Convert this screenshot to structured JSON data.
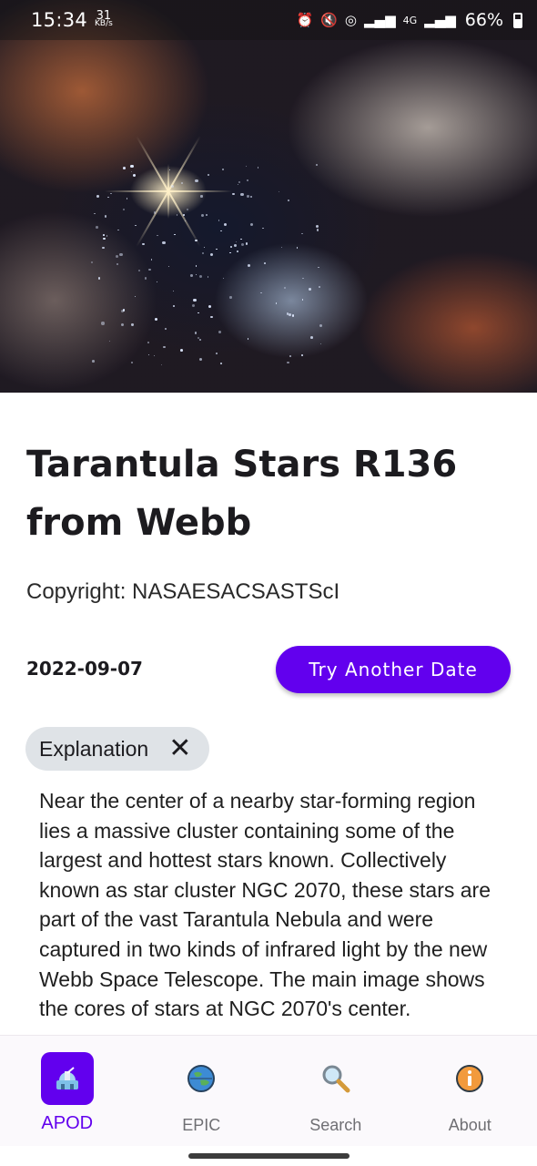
{
  "status_bar": {
    "time": "15:34",
    "net_speed_value": "31",
    "net_speed_unit": "KB/s",
    "network_type": "4G",
    "battery": "66%"
  },
  "hero": {
    "icon": "nebula-photo"
  },
  "apod": {
    "title": "Tarantula Stars R136 from Webb",
    "copyright": "Copyright: NASAESACSASTScI",
    "date": "2022-09-07",
    "try_another_label": "Try Another Date",
    "explanation_chip_label": "Explanation",
    "explanation_text": "Near the center of a nearby star-forming region lies a massive cluster containing some of the largest and hottest stars known.  Collectively known as star cluster NGC 2070, these stars are part of the vast Tarantula Nebula and were captured in two kinds of infrared light by the new Webb Space Telescope.  The main image shows the cores of stars at NGC 2070's center."
  },
  "bottom_nav": {
    "items": [
      {
        "label": "APOD",
        "icon": "telescope-icon",
        "active": true
      },
      {
        "label": "EPIC",
        "icon": "globe-icon",
        "active": false
      },
      {
        "label": "Search",
        "icon": "magnifier-icon",
        "active": false
      },
      {
        "label": "About",
        "icon": "info-icon",
        "active": false
      }
    ]
  },
  "colors": {
    "accent": "#6200ee",
    "chip_bg": "#dfe3e7",
    "nav_bg": "#fbf9fc"
  }
}
